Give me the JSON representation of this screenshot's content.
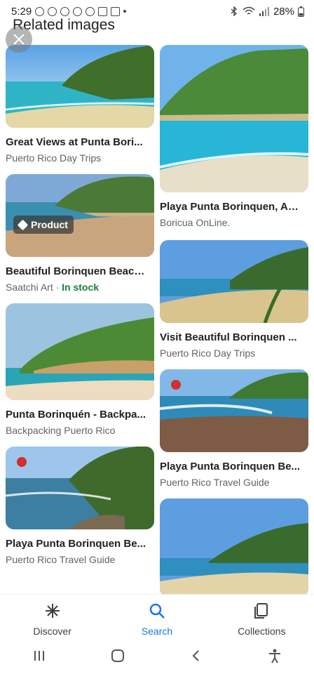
{
  "status_bar": {
    "time": "5:29",
    "battery": "28%"
  },
  "header": {
    "title": "Related images"
  },
  "cards": {
    "l0": {
      "title": "Great Views at Punta Bori...",
      "source": "Puerto Rico Day Trips"
    },
    "l1": {
      "title": "Beautiful Borinquen Beach...",
      "source": "Saatchi Art",
      "separator": " · ",
      "stock": "In stock",
      "badge": "Product"
    },
    "l2": {
      "title": "Punta Borinquén - Backpa...",
      "source": "Backpacking Puerto Rico"
    },
    "l3": {
      "title": "Playa Punta Borinquen Be...",
      "source": "Puerto Rico Travel Guide"
    },
    "r0": {
      "title": "Playa Punta Borinquen, Ag...",
      "source": "Boricua OnLine."
    },
    "r1": {
      "title": "Visit Beautiful Borinquen ...",
      "source": "Puerto Rico Day Trips"
    },
    "r2": {
      "title": "Playa Punta Borinquen Be...",
      "source": "Puerto Rico Travel Guide"
    }
  },
  "bottom_nav": {
    "discover": "Discover",
    "search": "Search",
    "collections": "Collections"
  },
  "colors": {
    "accent": "#1a73e8",
    "in_stock": "#188038"
  }
}
